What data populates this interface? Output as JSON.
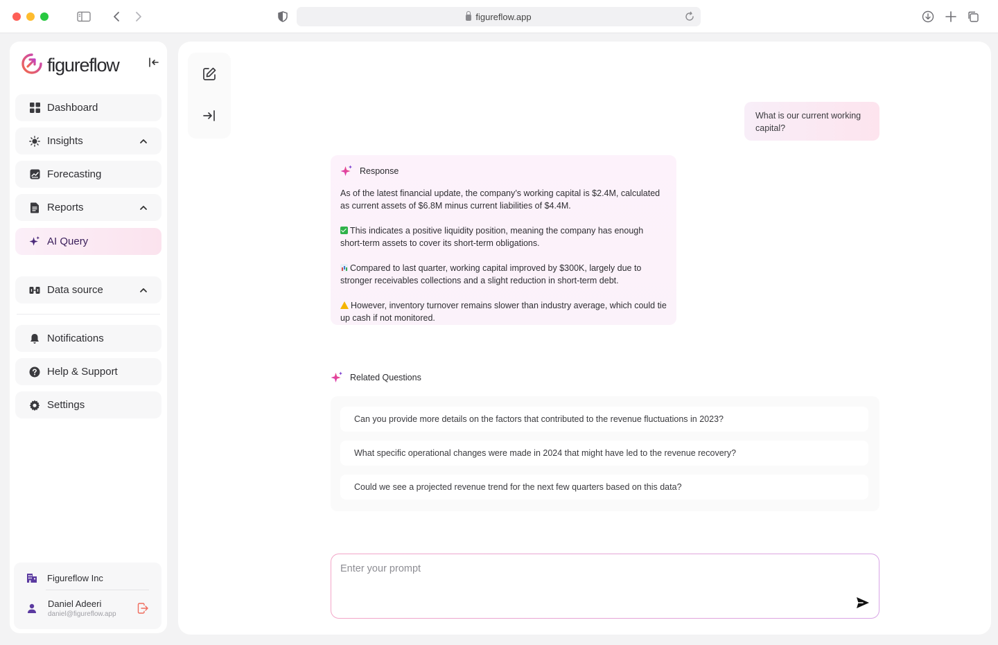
{
  "browser": {
    "url": "figureflow.app"
  },
  "sidebar": {
    "logo_text": "figureflow",
    "items": [
      {
        "label": "Dashboard",
        "icon": "dashboard-icon"
      },
      {
        "label": "Insights",
        "icon": "bulb-icon",
        "expandable": true
      },
      {
        "label": "Forecasting",
        "icon": "forecast-icon"
      },
      {
        "label": "Reports",
        "icon": "report-icon",
        "expandable": true
      },
      {
        "label": "AI Query",
        "icon": "sparkle-icon",
        "active": true
      },
      {
        "label": "Data source",
        "icon": "data-source-icon",
        "expandable": true
      },
      {
        "label": "Notifications",
        "icon": "bell-icon"
      },
      {
        "label": "Help & Support",
        "icon": "help-icon"
      },
      {
        "label": "Settings",
        "icon": "gear-icon"
      }
    ],
    "account": {
      "org": "Figureflow Inc",
      "name": "Daniel Adeeri",
      "email": "daniel@figureflow.app"
    }
  },
  "chat": {
    "user_message": "What is our current working capital?",
    "response": {
      "title": "Response",
      "p1": "As of the latest financial update, the company’s working capital is $2.4M, calculated as current assets of $6.8M minus current liabilities of $4.4M.",
      "p2": "This indicates a positive liquidity position, meaning the company has enough short-term assets to cover its short-term obligations.",
      "p3": "Compared to last quarter, working capital improved by $300K, largely due to stronger receivables collections and a slight reduction in short-term debt.",
      "p4": "However, inventory turnover remains slower than industry average, which could tie up cash if not monitored."
    },
    "related": {
      "title": "Related Questions",
      "questions": [
        "Can you provide more details on the factors that contributed to the revenue fluctuations in 2023?",
        "What specific operational changes were made in 2024 that might have led to the revenue recovery?",
        "Could we see a projected revenue trend for the next few quarters based on this data?"
      ]
    },
    "prompt": {
      "placeholder": "Enter your prompt",
      "value": ""
    }
  },
  "colors": {
    "brand_gradient_start": "#f26a4b",
    "brand_gradient_end": "#c23fc2",
    "active_bg": "#fbe6f1",
    "logout": "#ef6b5c"
  }
}
